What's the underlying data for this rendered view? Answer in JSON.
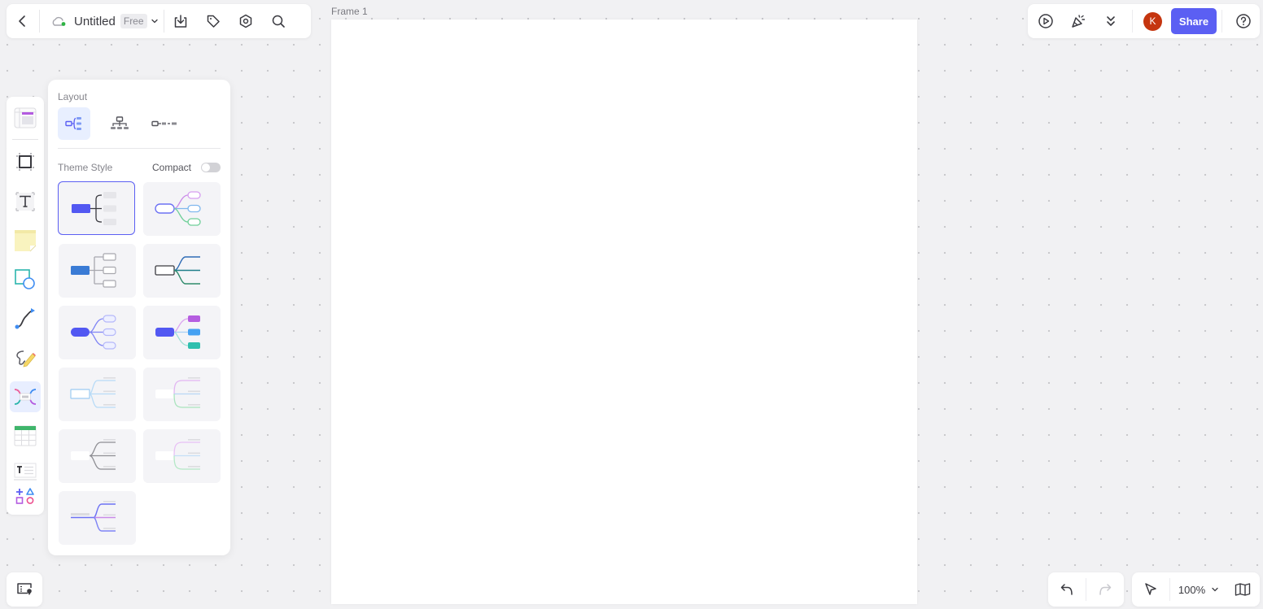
{
  "header": {
    "document_title": "Untitled",
    "plan_badge": "Free",
    "share_label": "Share",
    "avatar_initial": "K",
    "icons": {
      "back": "chevron-left-icon",
      "cloud": "cloud-saved-icon",
      "export": "download-icon",
      "tag": "tag-icon",
      "settings": "gear-icon",
      "search": "search-icon",
      "present": "play-icon",
      "celebrate": "party-popper-icon",
      "more": "double-chevron-down-icon",
      "help": "help-circle-icon"
    }
  },
  "canvas": {
    "frame_label": "Frame 1"
  },
  "toolbar": {
    "tools": [
      {
        "name": "template",
        "icon": "template-icon"
      },
      {
        "name": "frame",
        "icon": "frame-icon"
      },
      {
        "name": "text",
        "icon": "text-icon"
      },
      {
        "name": "sticky-note",
        "icon": "sticky-note-icon"
      },
      {
        "name": "shape",
        "icon": "shape-icon"
      },
      {
        "name": "connector",
        "icon": "connector-icon"
      },
      {
        "name": "pen",
        "icon": "pen-icon"
      },
      {
        "name": "mind-map",
        "icon": "mind-map-icon",
        "active": true
      },
      {
        "name": "table",
        "icon": "table-icon"
      },
      {
        "name": "text-block",
        "icon": "text-block-icon"
      },
      {
        "name": "more-shapes",
        "icon": "more-shapes-icon"
      }
    ]
  },
  "panel": {
    "layout_label": "Layout",
    "layouts": [
      {
        "name": "right-tree",
        "active": true
      },
      {
        "name": "org-chart",
        "active": false
      },
      {
        "name": "timeline",
        "active": false
      }
    ],
    "theme_label": "Theme Style",
    "compact_label": "Compact",
    "compact_on": false,
    "themes": [
      {
        "id": 1,
        "selected": true
      },
      {
        "id": 2,
        "selected": false
      },
      {
        "id": 3,
        "selected": false
      },
      {
        "id": 4,
        "selected": false
      },
      {
        "id": 5,
        "selected": false
      },
      {
        "id": 6,
        "selected": false
      },
      {
        "id": 7,
        "selected": false
      },
      {
        "id": 8,
        "selected": false
      },
      {
        "id": 9,
        "selected": false
      },
      {
        "id": 10,
        "selected": false
      },
      {
        "id": 11,
        "selected": false
      }
    ]
  },
  "footer": {
    "zoom_level": "100%",
    "icons": {
      "minimap": "map-location-icon",
      "undo": "undo-icon",
      "redo": "redo-icon",
      "select": "cursor-icon",
      "book": "book-open-icon"
    }
  },
  "colors": {
    "accent": "#5b5ff3",
    "avatar": "#c5350f",
    "canvas_bg": "#f1f1f3"
  }
}
